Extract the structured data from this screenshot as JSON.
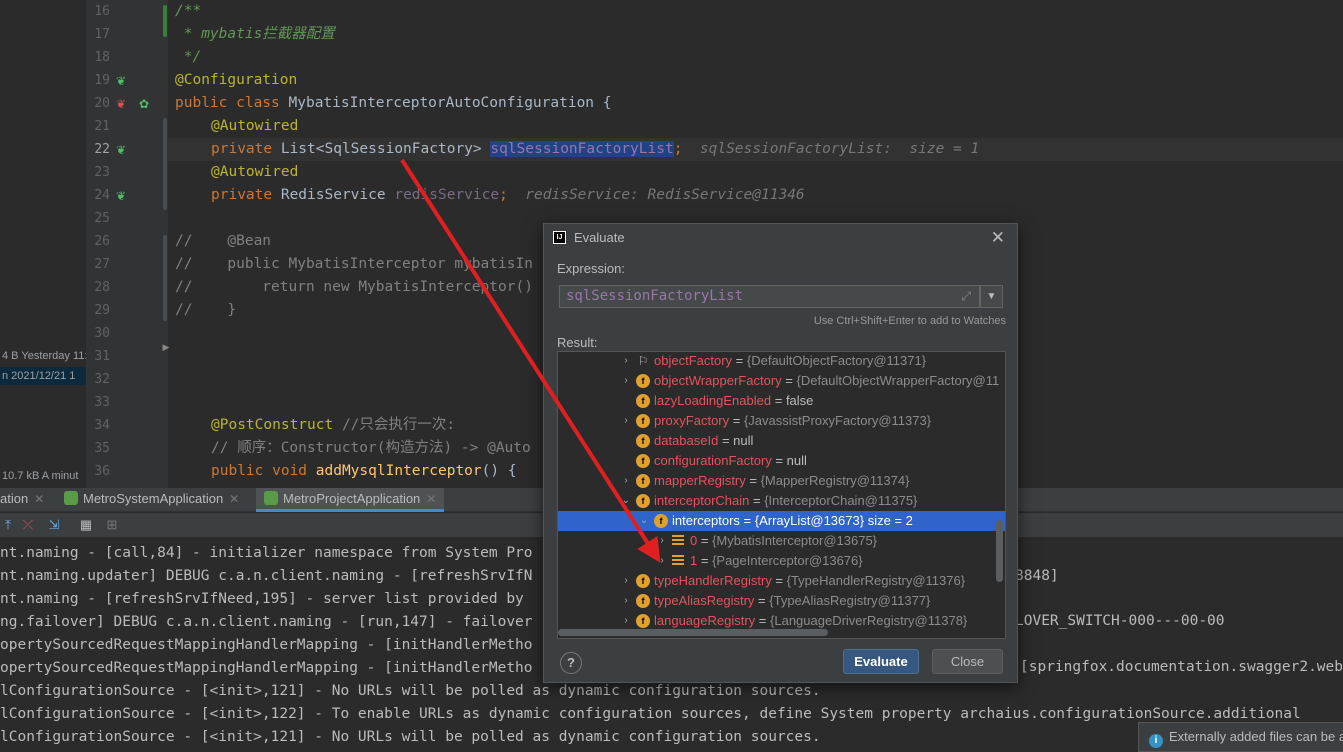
{
  "left_strip": {
    "rows": [
      {
        "text": "4 B  Yesterday 11:"
      },
      {
        "text": "n   2021/12/21 1"
      },
      {
        "text": "10.7 kB  A minut"
      }
    ]
  },
  "line_numbers": [
    "16",
    "17",
    "18",
    "19",
    "20",
    "21",
    "22",
    "23",
    "24",
    "25",
    "26",
    "27",
    "28",
    "29",
    "30",
    "31",
    "32",
    "33",
    "34",
    "35",
    "36"
  ],
  "code": {
    "l16": "/**",
    "l17": " * mybatis拦截器配置",
    "l18": " */",
    "l19_ann": "@Configuration",
    "l20_kw": "public class ",
    "l20_name": "MybatisInterceptorAutoConfiguration {",
    "l21_ann": "@Autowired",
    "l22_kw": "private ",
    "l22_type": "List<SqlSessionFactory> ",
    "l22_field": "sqlSessionFactoryList",
    "l22_end": ";",
    "l22_hint": "  sqlSessionFactoryList:  size = 1",
    "l23_ann": "@Autowired",
    "l24_kw": "private ",
    "l24_type": "RedisService ",
    "l24_field": "redisService",
    "l24_end": ";",
    "l24_hint": "  redisService: RedisService@11346",
    "l26": "//    @Bean",
    "l27": "//    public MybatisInterceptor mybatisIn",
    "l28": "//        return new MybatisInterceptor()",
    "l29": "//    }",
    "l34_ann": "@PostConstruct",
    "l34_cm": " //只会执行一次:",
    "l35": "// 顺序：Constructor(构造方法) -> @Auto",
    "l36_kw": "public void ",
    "l36_fn": "addMysqlInterceptor",
    "l36_end": "() {"
  },
  "run_tabs": [
    {
      "label": "ation"
    },
    {
      "label": "MetroSystemApplication"
    },
    {
      "label": "MetroProjectApplication"
    }
  ],
  "console_lines": [
    "nt.naming - [call,84] - initializer namespace from System Pro",
    "nt.naming.updater] DEBUG c.a.n.client.naming - [refreshSrvIfN",
    "nt.naming - [refreshSrvIfNeed,195] - server list provided by",
    "ng.failover] DEBUG c.a.n.client.naming - [run,147] - failover",
    "opertySourcedRequestMappingHandlerMapping - [initHandlerMetho",
    "opertySourcedRequestMappingHandlerMapping - [initHandlerMetho",
    "lConfigurationSource - [<init>,121] - No URLs will be polled as dynamic configuration sources.",
    "lConfigurationSource - [<init>,122] - To enable URLs as dynamic configuration sources, define System property archaius.configurationSource.additional",
    "lConfigurationSource - [<init>,121] - No URLs will be polled as dynamic configuration sources."
  ],
  "console_right": [
    {
      "text": "8848]"
    },
    {
      "text": "LOVER_SWITCH-000---00-00"
    },
    {
      "text": "[springfox.documentation.swagger2.web"
    }
  ],
  "notification": "Externally added files can be a",
  "dialog": {
    "title": "Evaluate",
    "expression_label": "Expression:",
    "expression_value": "sqlSessionFactoryList",
    "watch_hint": "Use Ctrl+Shift+Enter to add to Watches",
    "result_label": "Result:",
    "evaluate_button": "Evaluate",
    "close_button": "Close",
    "rows": [
      {
        "name": "objectFactory",
        "eq": " = ",
        "value": "{DefaultObjectFactory@11371}"
      },
      {
        "name": "objectWrapperFactory",
        "eq": " = ",
        "value": "{DefaultObjectWrapperFactory@11"
      },
      {
        "name": "lazyLoadingEnabled",
        "eq": " = ",
        "value": "false"
      },
      {
        "name": "proxyFactory",
        "eq": " = ",
        "value": "{JavassistProxyFactory@11373}"
      },
      {
        "name": "databaseId",
        "eq": " = ",
        "value": "null"
      },
      {
        "name": "configurationFactory",
        "eq": " = ",
        "value": "null"
      },
      {
        "name": "mapperRegistry",
        "eq": " = ",
        "value": "{MapperRegistry@11374}"
      },
      {
        "name": "interceptorChain",
        "eq": " = ",
        "value": "{InterceptorChain@11375}"
      },
      {
        "name": "interceptors",
        "eq": " = ",
        "value": "{ArrayList@13673}",
        "extra": "  size = 2"
      },
      {
        "name": "0",
        "eq": " = ",
        "value": "{MybatisInterceptor@13675}"
      },
      {
        "name": "1",
        "eq": " = ",
        "value": "{PageInterceptor@13676}"
      },
      {
        "name": "typeHandlerRegistry",
        "eq": " = ",
        "value": "{TypeHandlerRegistry@11376}"
      },
      {
        "name": "typeAliasRegistry",
        "eq": " = ",
        "value": "{TypeAliasRegistry@11377}"
      },
      {
        "name": "languageRegistry",
        "eq": " = ",
        "value": "{LanguageDriverRegistry@11378}"
      }
    ]
  }
}
